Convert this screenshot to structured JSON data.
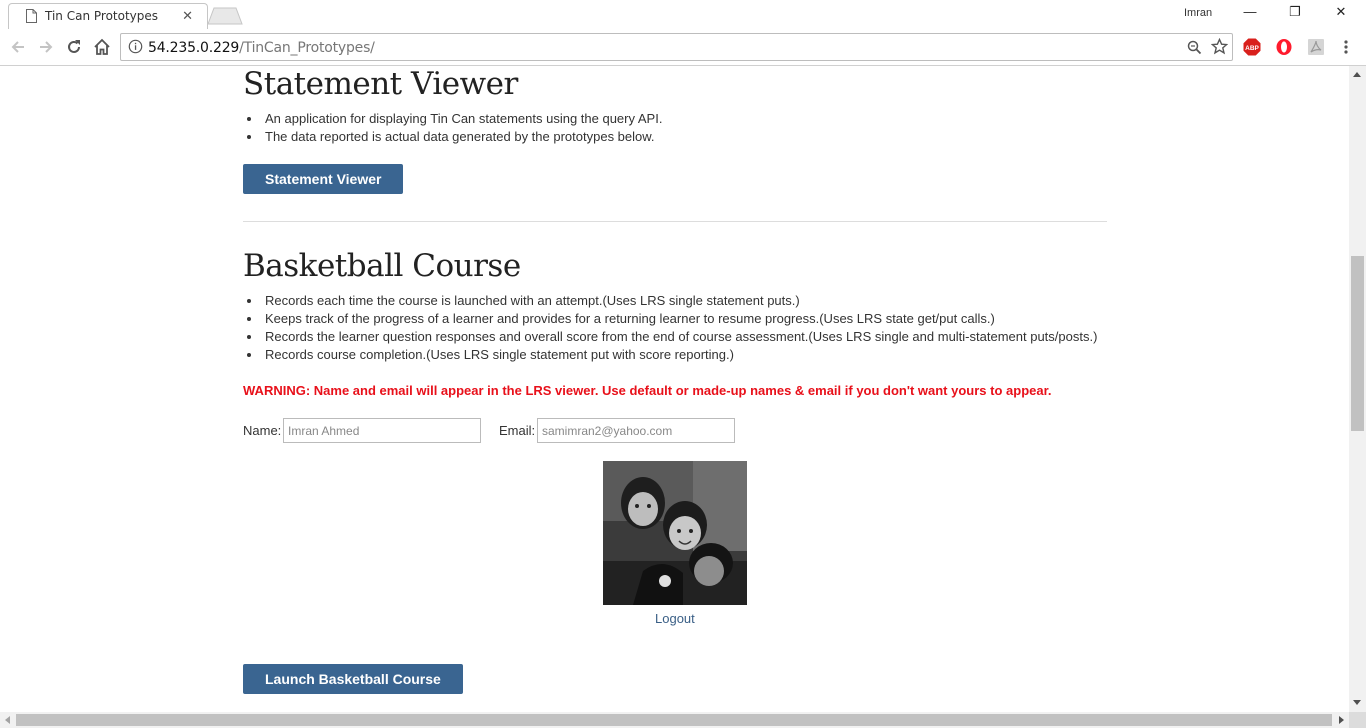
{
  "browser": {
    "tab_title": "Tin Can Prototypes",
    "tab_close": "✕",
    "profile_name": "Imran",
    "url_host": "54.235.0.229",
    "url_path": "/TinCan_Prototypes/",
    "window_controls": {
      "minimize": "—",
      "restore": "❐",
      "close": "✕"
    },
    "extensions": [
      "abp-icon",
      "opera-icon",
      "pdf-icon",
      "menu-icon"
    ],
    "abp_label": "ABP"
  },
  "statement_viewer": {
    "title": "Statement Viewer",
    "bullets": [
      "An application for displaying Tin Can statements using the query API.",
      "The data reported is actual data generated by the prototypes below."
    ],
    "button_label": "Statement Viewer"
  },
  "basketball": {
    "title": "Basketball Course",
    "bullets": [
      "Records each time the course is launched with an attempt.(Uses LRS single statement puts.)",
      "Keeps track of the progress of a learner and provides for a returning learner to resume progress.(Uses LRS state get/put calls.)",
      "Records the learner question responses and overall score from the end of course assessment.(Uses LRS single and multi-statement puts/posts.)",
      "Records course completion.(Uses LRS single statement put with score reporting.)"
    ],
    "warning": "WARNING: Name and email will appear in the LRS viewer. Use default or made-up names & email if you don't want yours to appear.",
    "name_label": "Name:",
    "name_value": "Imran Ahmed",
    "email_label": "Email:",
    "email_value": "samimran2@yahoo.com",
    "logout_label": "Logout",
    "launch_button_label": "Launch Basketball Course"
  },
  "colors": {
    "button_bg": "#3a6591",
    "warning_text": "#e8101a",
    "link": "#3a5f86"
  }
}
